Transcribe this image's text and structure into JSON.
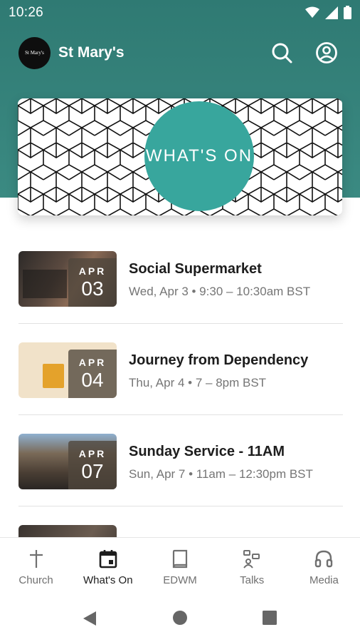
{
  "status_bar": {
    "time": "10:26"
  },
  "app_bar": {
    "title": "St Mary's",
    "logo_text": "St Mary's"
  },
  "banner": {
    "text": "WHAT'S ON"
  },
  "events": [
    {
      "month": "APR",
      "day": "03",
      "title": "Social Supermarket",
      "when": "Wed, Apr 3 • 9:30 – 10:30am BST"
    },
    {
      "month": "APR",
      "day": "04",
      "title": "Journey from Dependency",
      "when": "Thu, Apr 4 • 7 – 8pm BST"
    },
    {
      "month": "APR",
      "day": "07",
      "title": "Sunday Service - 11AM",
      "when": "Sun, Apr 7 • 11am – 12:30pm BST"
    }
  ],
  "bottom_nav": [
    {
      "label": "Church",
      "icon": "cross-icon",
      "active": false
    },
    {
      "label": "What's On",
      "icon": "calendar-icon",
      "active": true
    },
    {
      "label": "EDWM",
      "icon": "book-icon",
      "active": false
    },
    {
      "label": "Talks",
      "icon": "talks-icon",
      "active": false
    },
    {
      "label": "Media",
      "icon": "headphones-icon",
      "active": false
    }
  ],
  "colors": {
    "header": "#2f7a73",
    "accent": "#38a69d",
    "text_primary": "#1d1d1d",
    "text_secondary": "#757575"
  }
}
